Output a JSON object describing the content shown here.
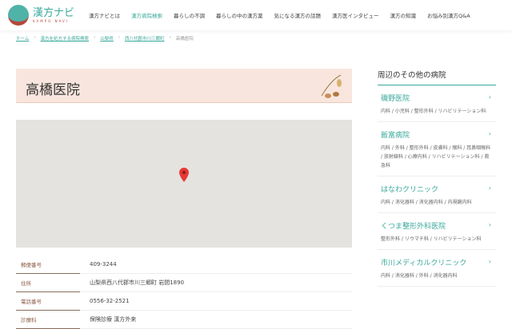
{
  "header": {
    "logo_title": "漢方ナビ",
    "logo_sub": "KAMPO NAVI",
    "nav": [
      "漢方ナビとは",
      "漢方病院検索",
      "暮らしの不調",
      "暮らしの中の漢方薬",
      "気になる漢方の話題",
      "漢方医インタビュー",
      "漢方の知識",
      "お悩み別漢方Q&A"
    ]
  },
  "breadcrumb": [
    "ホーム",
    "漢方を処方する病院検索",
    "山梨県",
    "西八代郡市川三郷町",
    "高橋医院"
  ],
  "title": "高橋医院",
  "info": [
    {
      "k": "郵便番号",
      "v": "409-3244"
    },
    {
      "k": "住所",
      "v": "山梨県西八代郡市川三郷町 岩間1890"
    },
    {
      "k": "電話番号",
      "v": "0556-32-2521"
    },
    {
      "k": "診療科",
      "v": "保険診療 漢方外来"
    }
  ],
  "sidebar": {
    "title": "周辺のその他の病院",
    "items": [
      {
        "name": "磯野医院",
        "deps": "内科 / 小児科 / 整形外科 / リハビリテーション科"
      },
      {
        "name": "飯富病院",
        "deps": "内科 / 外科 / 整形外科 / 皮膚科 / 眼科 / 耳鼻咽喉科 / 放射線科 / 心療内科 / リハビリテーション科 / 救急科"
      },
      {
        "name": "はなわクリニック",
        "deps": "内科 / 消化器科 / 消化器内科 / 内視鏡内科"
      },
      {
        "name": "くつま整形外科医院",
        "deps": "整形外科 / リウマチ科 / リハビリテーション科"
      },
      {
        "name": "市川メディカルクリニック",
        "deps": "内科 / 消化器科 / 外科 / 消化器内科"
      }
    ]
  }
}
